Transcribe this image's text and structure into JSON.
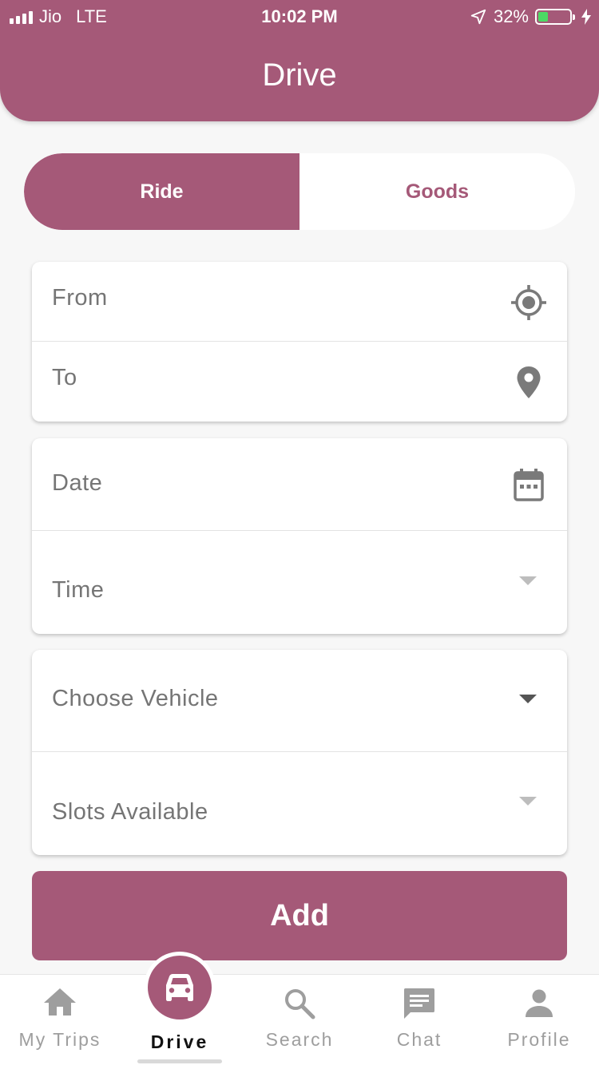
{
  "status_bar": {
    "carrier": "Jio",
    "network": "LTE",
    "time": "10:02 PM",
    "battery_percent": "32%",
    "battery_level": 0.32,
    "icons": [
      "signal-icon",
      "location-arrow-icon",
      "battery-icon",
      "charging-bolt-icon"
    ]
  },
  "header": {
    "title": "Drive"
  },
  "segment": {
    "ride_label": "Ride",
    "goods_label": "Goods",
    "selected": "Ride"
  },
  "route_card": {
    "from_placeholder": "From",
    "to_placeholder": "To",
    "from_icon": "gps-target-icon",
    "to_icon": "map-pin-icon"
  },
  "schedule_card": {
    "date_placeholder": "Date",
    "time_placeholder": "Time",
    "date_icon": "calendar-icon",
    "time_icon": "dropdown-arrow-icon"
  },
  "vehicle_card": {
    "vehicle_placeholder": "Choose Vehicle",
    "slots_placeholder": "Slots Available"
  },
  "add_button": {
    "label": "Add"
  },
  "bottom_nav": {
    "items": [
      {
        "label": "My Trips",
        "icon": "home-icon"
      },
      {
        "label": "Drive",
        "icon": "car-icon",
        "active": true
      },
      {
        "label": "Search",
        "icon": "search-icon"
      },
      {
        "label": "Chat",
        "icon": "chat-icon"
      },
      {
        "label": "Profile",
        "icon": "person-icon"
      }
    ]
  },
  "colors": {
    "accent": "#a55978",
    "background": "#f7f7f7",
    "placeholder_text": "#757575",
    "icon_gray": "#7a7a7a"
  }
}
